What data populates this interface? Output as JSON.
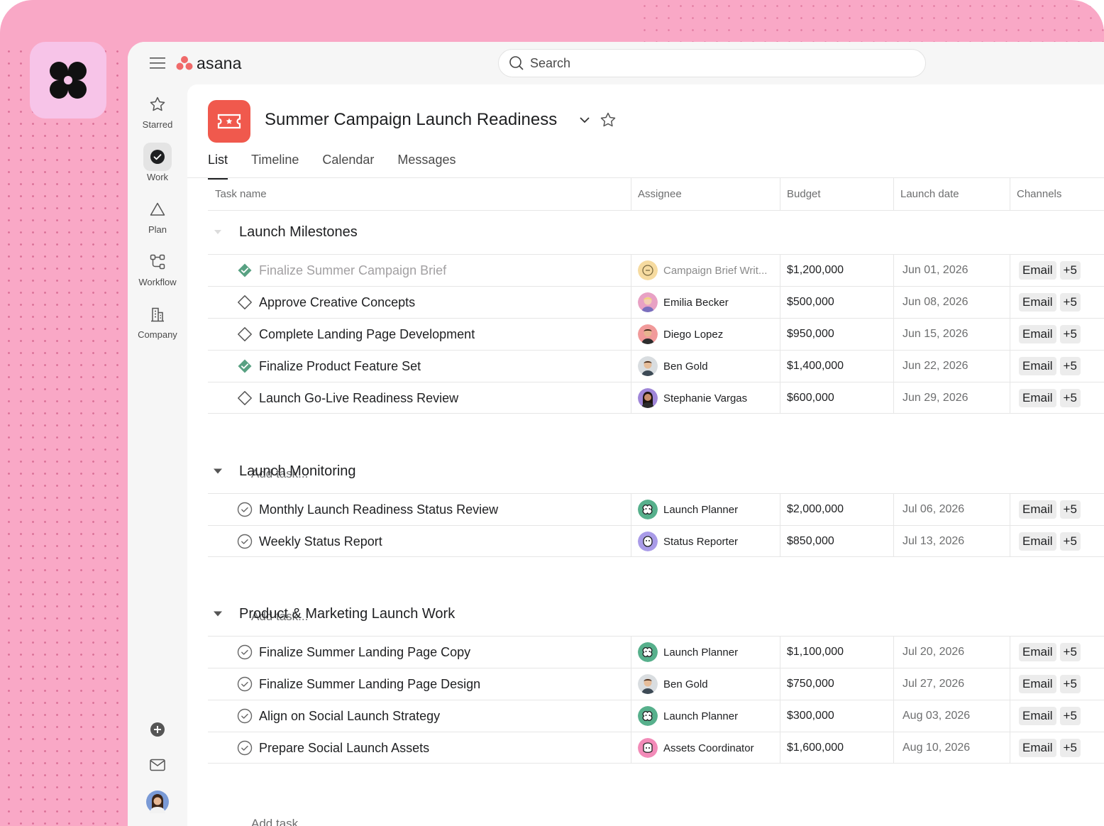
{
  "brand": {
    "name": "asana",
    "logo_colors": [
      "#f06a6a"
    ]
  },
  "search": {
    "placeholder": "Search"
  },
  "sidebar": {
    "items": [
      {
        "label": "Starred",
        "icon": "star-icon"
      },
      {
        "label": "Work",
        "icon": "check-circle-icon"
      },
      {
        "label": "Plan",
        "icon": "triangle-icon"
      },
      {
        "label": "Workflow",
        "icon": "workflow-icon"
      },
      {
        "label": "Company",
        "icon": "building-icon"
      }
    ],
    "bottom": [
      "plus-circle-icon",
      "mail-icon",
      "user-avatar"
    ]
  },
  "project": {
    "title": "Summer Campaign Launch Readiness",
    "icon_color": "#f0594d"
  },
  "tabs": [
    {
      "label": "List",
      "active": true
    },
    {
      "label": "Timeline"
    },
    {
      "label": "Calendar"
    },
    {
      "label": "Messages"
    }
  ],
  "columns": {
    "task": "Task name",
    "assignee": "Assignee",
    "budget": "Budget",
    "date": "Launch date",
    "channels": "Channels"
  },
  "add_task_label": "Add task...",
  "sections": [
    {
      "title": "Launch Milestones",
      "rows": [
        {
          "type": "milestone-done",
          "name": "Finalize Summer Campaign Brief",
          "assignee": "Campaign Brief Writ...",
          "avatar": "bot-yellow",
          "budget": "$1,200,000",
          "date": "Jun 01, 2026",
          "channel": "Email",
          "extra": "+5"
        },
        {
          "type": "milestone",
          "name": "Approve Creative Concepts",
          "assignee": "Emilia Becker",
          "avatar": "person-pink",
          "budget": "$500,000",
          "date": "Jun 08, 2026",
          "channel": "Email",
          "extra": "+5"
        },
        {
          "type": "milestone",
          "name": "Complete Landing Page Development",
          "assignee": "Diego Lopez",
          "avatar": "person-red",
          "budget": "$950,000",
          "date": "Jun 15, 2026",
          "channel": "Email",
          "extra": "+5"
        },
        {
          "type": "milestone-done",
          "name": "Finalize Product Feature Set",
          "assignee": "Ben Gold",
          "avatar": "person-grey",
          "budget": "$1,400,000",
          "date": "Jun 22, 2026",
          "channel": "Email",
          "extra": "+5"
        },
        {
          "type": "milestone",
          "name": "Launch Go-Live Readiness Review",
          "assignee": "Stephanie Vargas",
          "avatar": "person-purple",
          "budget": "$600,000",
          "date": "Jun 29, 2026",
          "channel": "Email",
          "extra": "+5"
        }
      ]
    },
    {
      "title": "Launch Monitoring",
      "rows": [
        {
          "type": "task",
          "name": "Monthly Launch Readiness Status Review",
          "assignee": "Launch Planner",
          "avatar": "bot-green",
          "budget": "$2,000,000",
          "date": "Jul 06, 2026",
          "channel": "Email",
          "extra": "+5"
        },
        {
          "type": "task",
          "name": "Weekly Status Report",
          "assignee": "Status Reporter",
          "avatar": "bot-purple",
          "budget": "$850,000",
          "date": "Jul 13, 2026",
          "channel": "Email",
          "extra": "+5"
        }
      ]
    },
    {
      "title": "Product & Marketing Launch Work",
      "rows": [
        {
          "type": "task",
          "name": "Finalize Summer Landing Page Copy",
          "assignee": "Launch Planner",
          "avatar": "bot-green",
          "budget": "$1,100,000",
          "date": "Jul 20, 2026",
          "channel": "Email",
          "extra": "+5"
        },
        {
          "type": "task",
          "name": "Finalize Summer Landing Page Design",
          "assignee": "Ben Gold",
          "avatar": "person-grey",
          "budget": "$750,000",
          "date": "Jul 27, 2026",
          "channel": "Email",
          "extra": "+5"
        },
        {
          "type": "task",
          "name": "Align on Social Launch Strategy",
          "assignee": "Launch Planner",
          "avatar": "bot-green",
          "budget": "$300,000",
          "date": "Aug 03, 2026",
          "channel": "Email",
          "extra": "+5"
        },
        {
          "type": "task",
          "name": "Prepare Social Launch Assets",
          "assignee": "Assets Coordinator",
          "avatar": "bot-pink",
          "budget": "$1,600,000",
          "date": "Aug 10, 2026",
          "channel": "Email",
          "extra": "+5"
        }
      ]
    }
  ]
}
